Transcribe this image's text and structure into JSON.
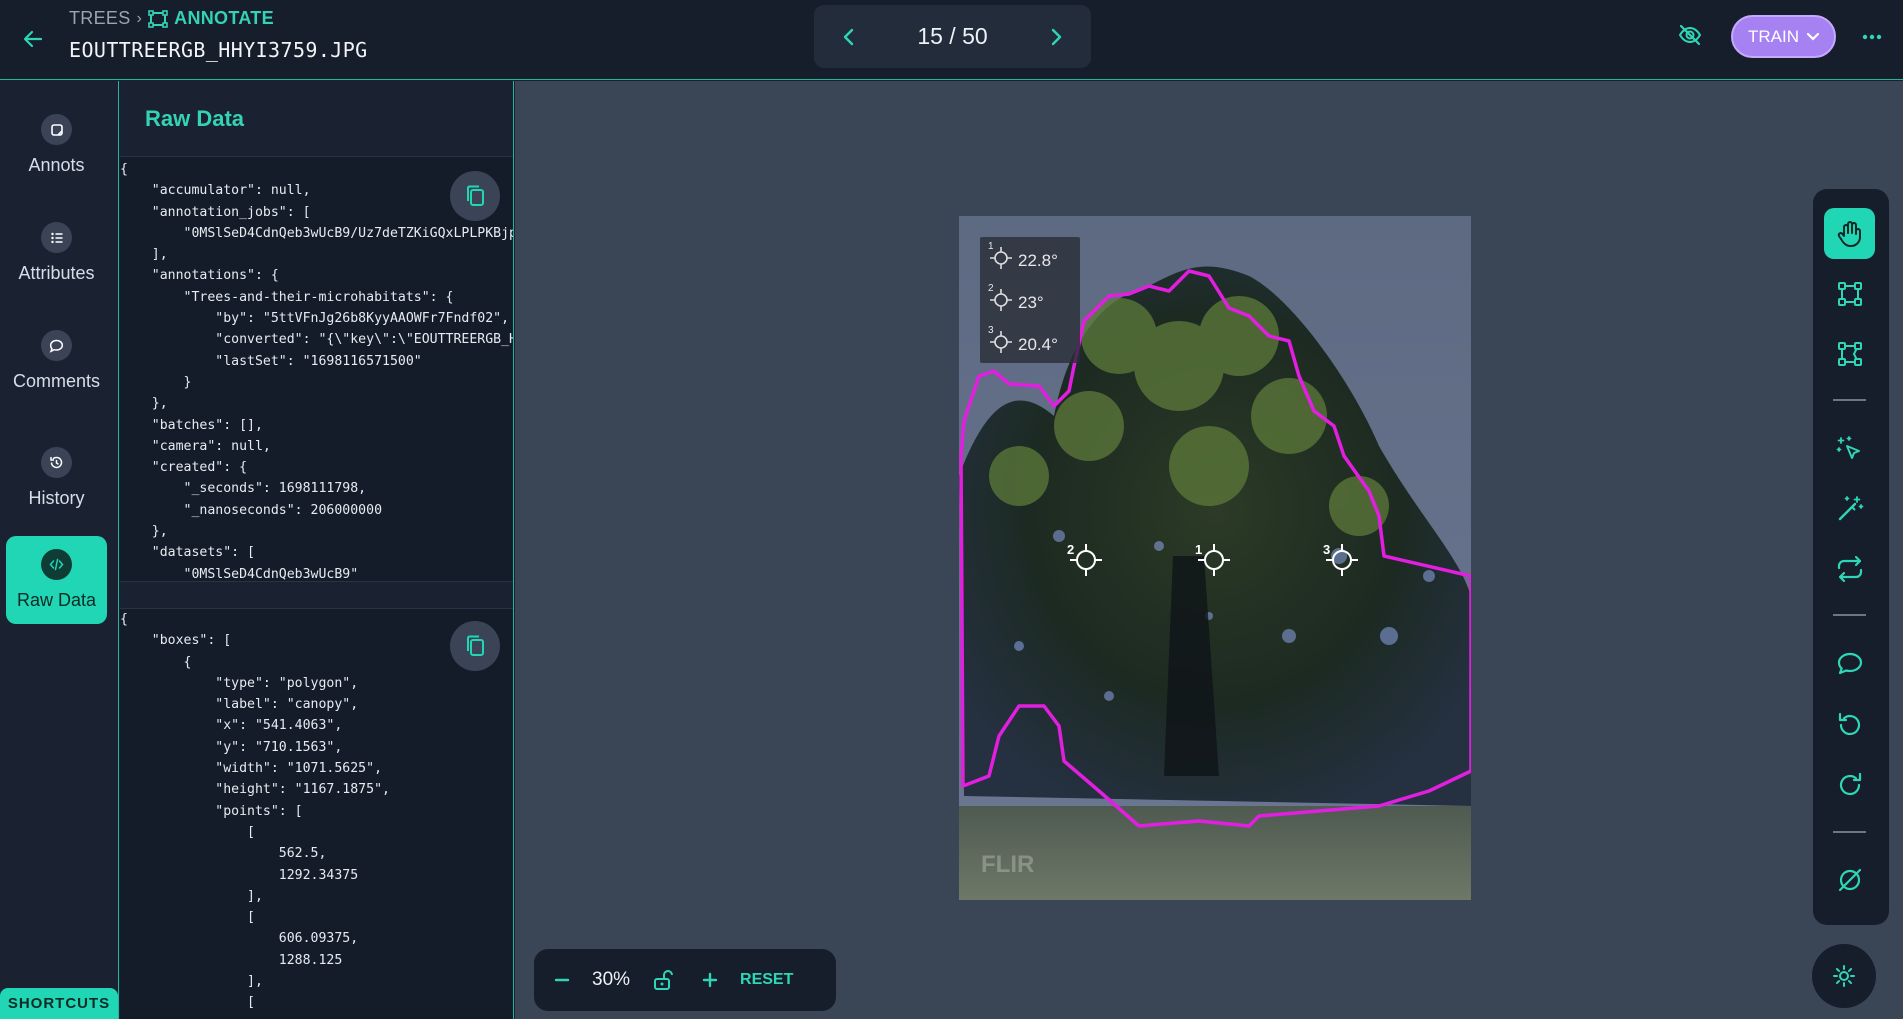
{
  "header": {
    "breadcrumb_root": "TREES",
    "breadcrumb_current": "ANNOTATE",
    "filename": "EOUTTREERGB_HHYI3759.JPG",
    "pager_label": "15 / 50",
    "train_label": "TRAIN"
  },
  "nav": {
    "items": [
      {
        "label": "Annots",
        "icon": "annotation-icon"
      },
      {
        "label": "Attributes",
        "icon": "list-icon"
      },
      {
        "label": "Comments",
        "icon": "chat-bubble-icon"
      },
      {
        "label": "History",
        "icon": "history-icon"
      },
      {
        "label": "Raw Data",
        "icon": "code-icon",
        "active": true
      }
    ],
    "shortcuts_label": "SHORTCUTS"
  },
  "panel": {
    "title": "Raw Data",
    "json_top": "{\n    \"accumulator\": null,\n    \"annotation_jobs\": [\n        \"0MSlSeD4CdnQeb3wUcB9/Uz7deTZKiGQxLPLPKBjp\n    ],\n    \"annotations\": {\n        \"Trees-and-their-microhabitats\": {\n            \"by\": \"5ttVFnJg26b8KyyAAOWFr7Fndf02\",\n            \"converted\": \"{\\\"key\\\":\\\"EOUTTREERGB_H\n            \"lastSet\": \"1698116571500\"\n        }\n    },\n    \"batches\": [],\n    \"camera\": null,\n    \"created\": {\n        \"_seconds\": 1698111798,\n        \"_nanoseconds\": 206000000\n    },\n    \"datasets\": [\n        \"0MSlSeD4CdnQeb3wUcB9\"",
    "json_bottom": "{\n    \"boxes\": [\n        {\n            \"type\": \"polygon\",\n            \"label\": \"canopy\",\n            \"x\": \"541.4063\",\n            \"y\": \"710.1563\",\n            \"width\": \"1071.5625\",\n            \"height\": \"1167.1875\",\n            \"points\": [\n                [\n                    562.5,\n                    1292.34375\n                ],\n                [\n                    606.09375,\n                    1288.125\n                ],\n                ["
  },
  "image": {
    "readouts": [
      {
        "index": "1",
        "value": "22.8°"
      },
      {
        "index": "2",
        "value": "23°"
      },
      {
        "index": "3",
        "value": "20.4°"
      }
    ],
    "markers": [
      "2",
      "1",
      "3"
    ],
    "watermark": "FLIR",
    "polygon_color": "#e21fe0"
  },
  "zoom": {
    "value": "30%",
    "reset_label": "RESET"
  },
  "tools": [
    "hand-pan-icon",
    "bounding-box-icon",
    "polygon-box-icon",
    "magic-cursor-icon",
    "magic-wand-icon",
    "repeat-icon",
    "comment-icon",
    "undo-icon",
    "redo-icon",
    "no-annotation-icon"
  ],
  "colors": {
    "accent": "#21d6b4",
    "train": "#a681f2",
    "background": "#1a2130"
  }
}
